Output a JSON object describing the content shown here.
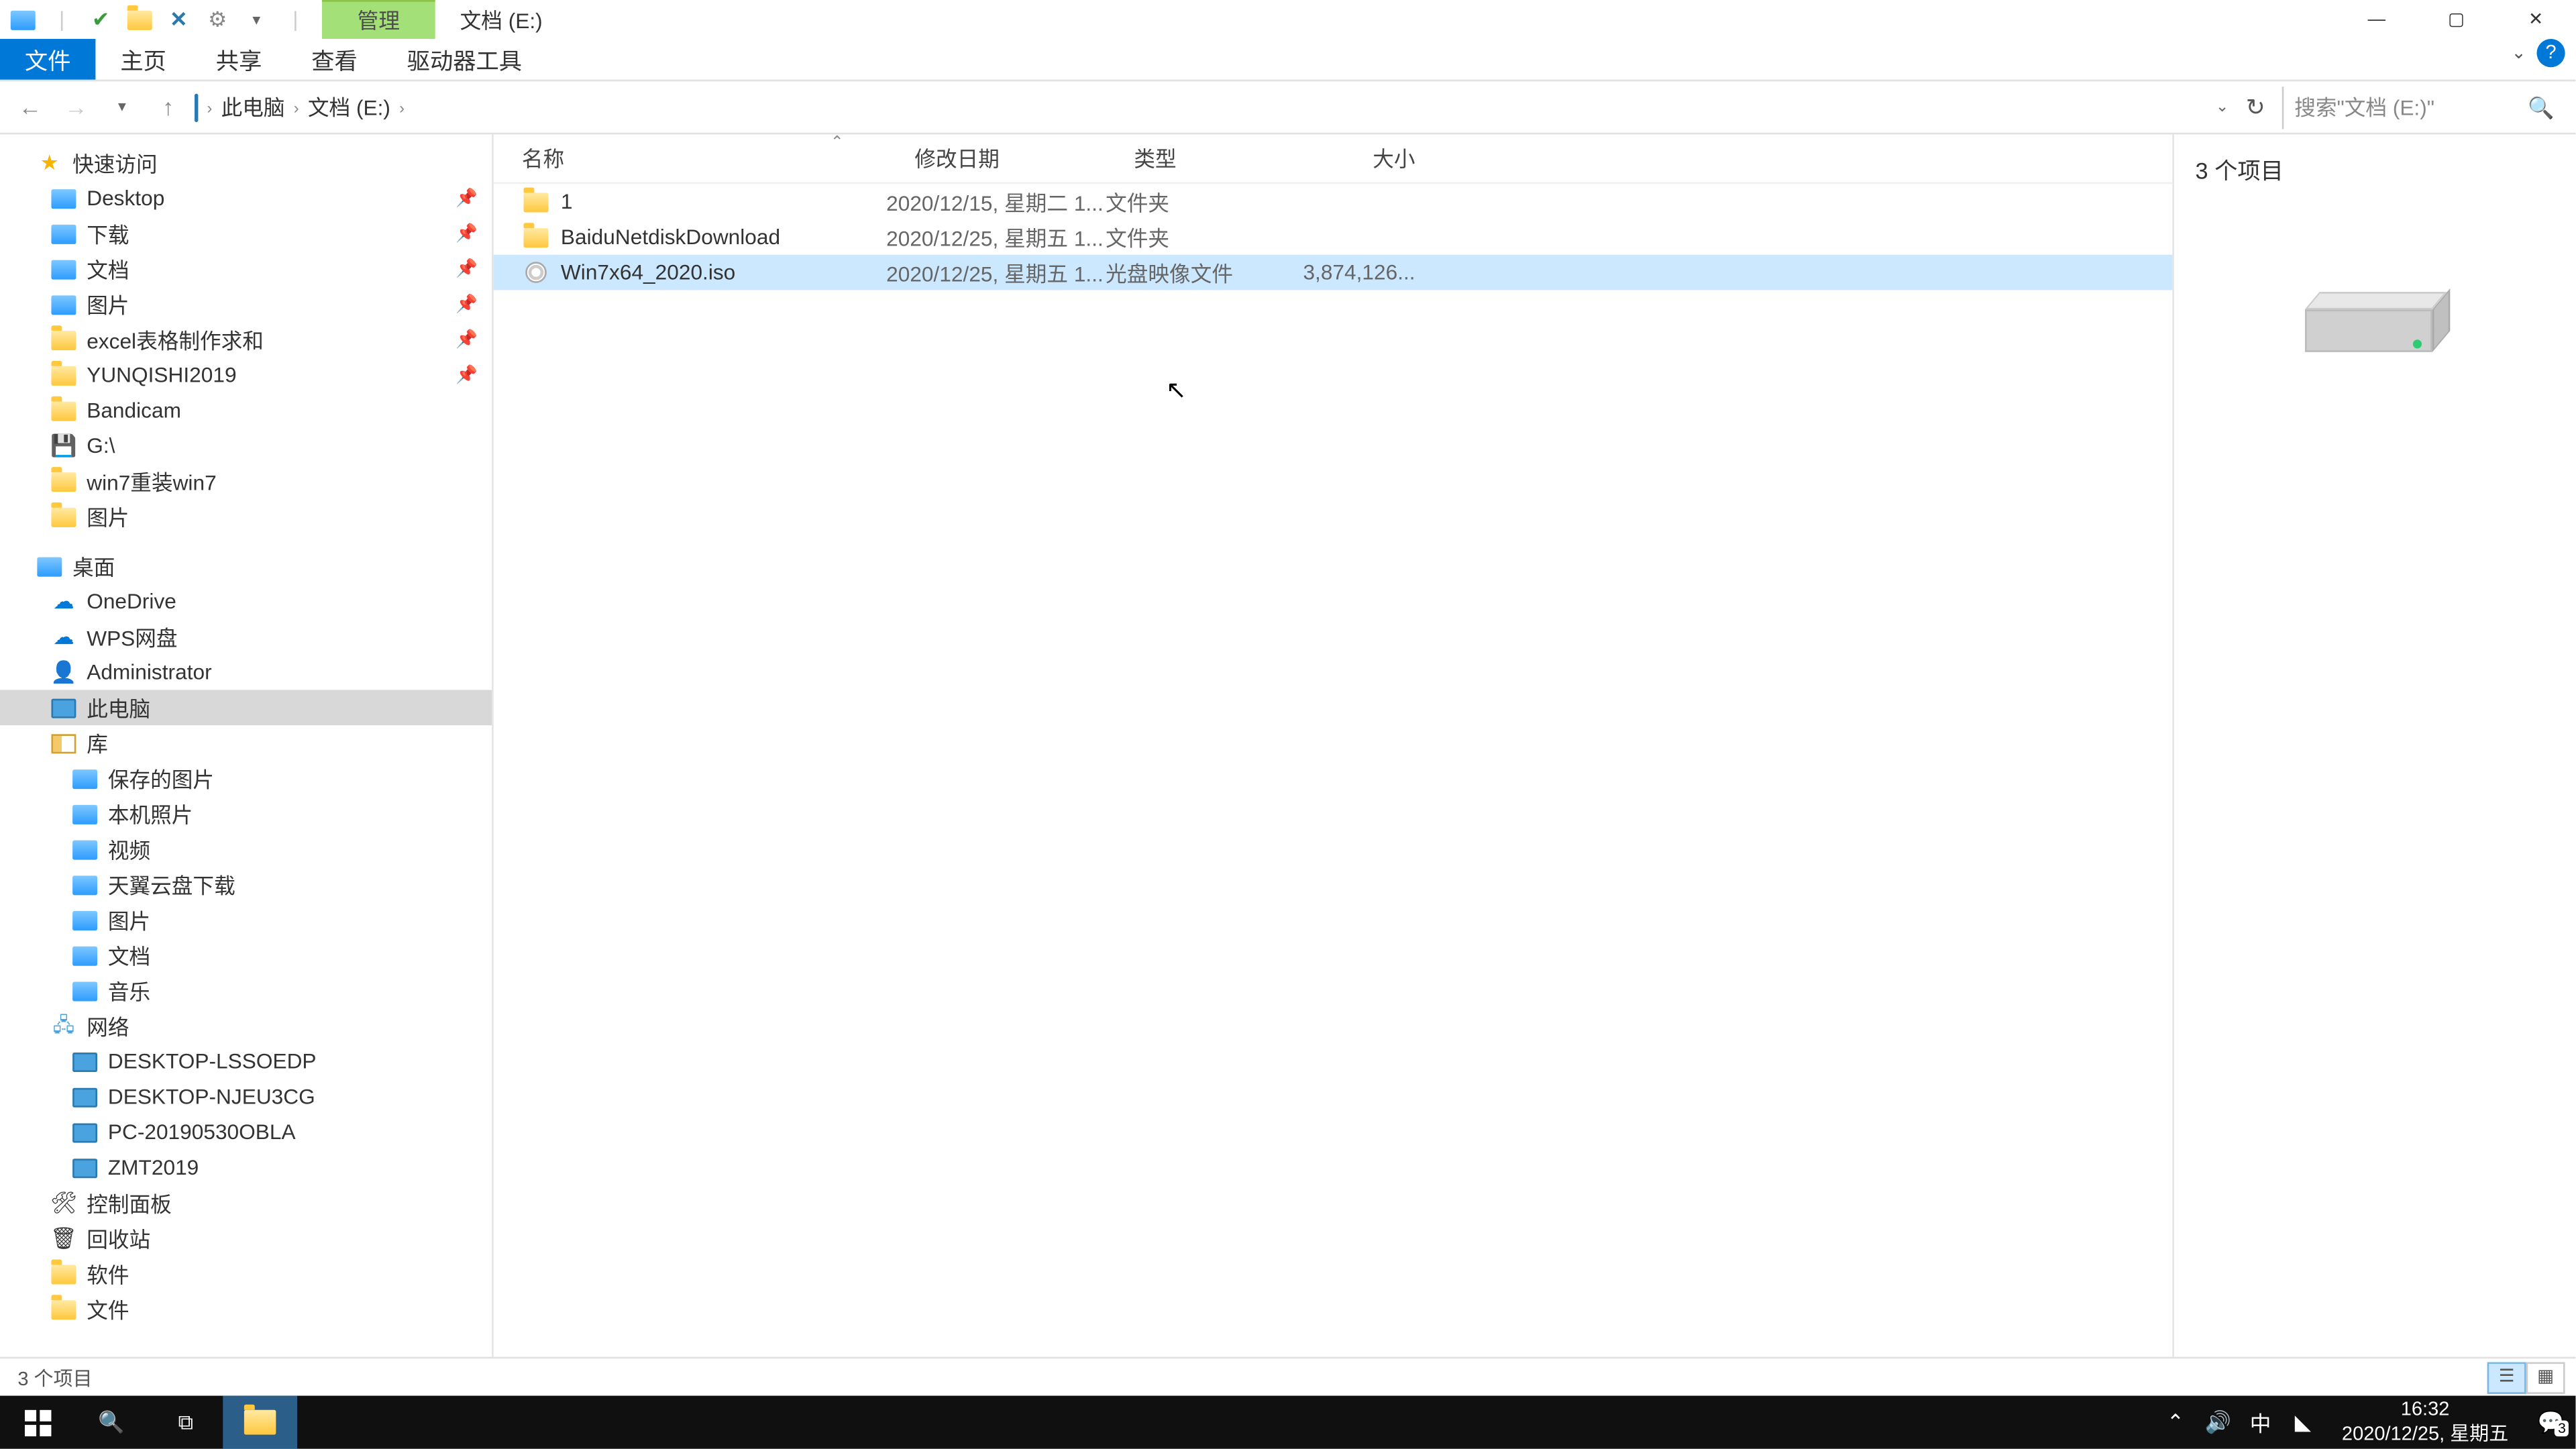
{
  "titlebar": {
    "context_tab": "管理",
    "title": "文档 (E:)"
  },
  "ribbon": {
    "file": "文件",
    "home": "主页",
    "share": "共享",
    "view": "查看",
    "drive_tools": "驱动器工具"
  },
  "breadcrumb": {
    "seg1": "此电脑",
    "seg2": "文档 (E:)"
  },
  "search": {
    "placeholder": "搜索\"文档 (E:)\""
  },
  "sidebar": {
    "quick_access": "快速访问",
    "desktop": "Desktop",
    "downloads": "下载",
    "documents": "文档",
    "pictures": "图片",
    "excel_req": "excel表格制作求和",
    "yunqishi": "YUNQISHI2019",
    "bandicam": "Bandicam",
    "g_drive": "G:\\",
    "win7": "win7重装win7",
    "pictures2": "图片",
    "desktop_cn": "桌面",
    "onedrive": "OneDrive",
    "wps": "WPS网盘",
    "admin": "Administrator",
    "this_pc": "此电脑",
    "library": "库",
    "saved_pics": "保存的图片",
    "camera_roll": "本机照片",
    "videos": "视频",
    "tianyi": "天翼云盘下载",
    "lib_pictures": "图片",
    "lib_documents": "文档",
    "lib_music": "音乐",
    "network": "网络",
    "net1": "DESKTOP-LSSOEDP",
    "net2": "DESKTOP-NJEU3CG",
    "net3": "PC-20190530OBLA",
    "net4": "ZMT2019",
    "control_panel": "控制面板",
    "recycle": "回收站",
    "software": "软件",
    "files": "文件"
  },
  "columns": {
    "name": "名称",
    "date": "修改日期",
    "type": "类型",
    "size": "大小"
  },
  "files": [
    {
      "name": "1",
      "date": "2020/12/15, 星期二 1...",
      "type": "文件夹",
      "size": "",
      "icon": "folder"
    },
    {
      "name": "BaiduNetdiskDownload",
      "date": "2020/12/25, 星期五 1...",
      "type": "文件夹",
      "size": "",
      "icon": "folder"
    },
    {
      "name": "Win7x64_2020.iso",
      "date": "2020/12/25, 星期五 1...",
      "type": "光盘映像文件",
      "size": "3,874,126...",
      "icon": "disc"
    }
  ],
  "preview": {
    "count_label": "3 个项目"
  },
  "status": {
    "text": "3 个项目"
  },
  "taskbar": {
    "ime": "中",
    "time": "16:32",
    "date": "2020/12/25, 星期五",
    "notif_badge": "3"
  }
}
